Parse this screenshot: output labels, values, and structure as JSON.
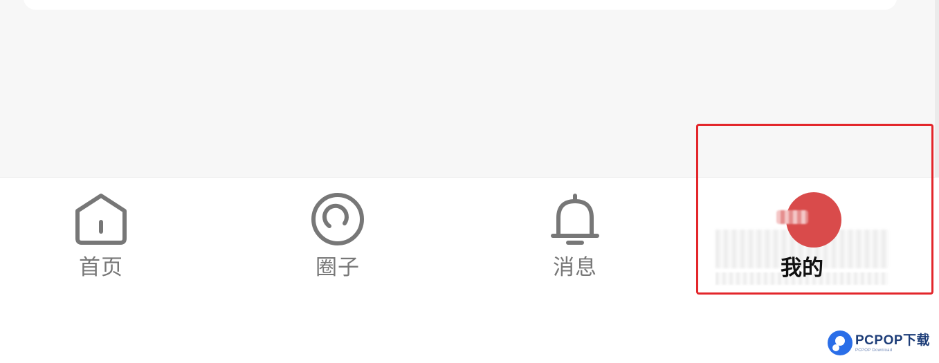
{
  "tabs": [
    {
      "id": "home",
      "label": "首页",
      "icon": "home-icon"
    },
    {
      "id": "circle",
      "label": "圈子",
      "icon": "circle-icon"
    },
    {
      "id": "message",
      "label": "消息",
      "icon": "bell-icon"
    },
    {
      "id": "me",
      "label": "我的",
      "icon": "avatar",
      "active": true
    }
  ],
  "colors": {
    "icon_gray": "#777777",
    "active_text": "#111111",
    "avatar_red": "#d94b4b",
    "highlight_red": "#e3262b",
    "watermark_blue": "#2a6ee8"
  },
  "watermark": {
    "title": "PCPOP下载",
    "subtitle": "PCPOP Download"
  }
}
